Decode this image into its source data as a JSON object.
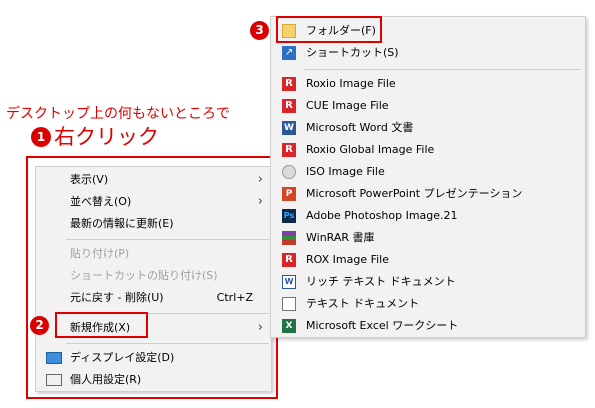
{
  "annotations": {
    "desc": "デスクトップ上の何もないところで",
    "step1_number": "1",
    "step1_label": "右クリック",
    "step2_number": "2",
    "step3_number": "3"
  },
  "context_menu": {
    "items": [
      {
        "label": "表示(V)"
      },
      {
        "label": "並べ替え(O)"
      },
      {
        "label": "最新の情報に更新(E)"
      },
      {
        "label": "貼り付け(P)"
      },
      {
        "label": "ショートカットの貼り付け(S)"
      },
      {
        "label": "元に戻す - 削除(U)",
        "shortcut": "Ctrl+Z"
      },
      {
        "label": "新規作成(X)"
      },
      {
        "label": "ディスプレイ設定(D)"
      },
      {
        "label": "個人用設定(R)"
      }
    ],
    "submenu_arrow": "›"
  },
  "new_submenu": {
    "items": [
      {
        "label": "フォルダー(F)",
        "icon": "folder-icon"
      },
      {
        "label": "ショートカット(S)",
        "icon": "shortcut-icon"
      },
      {
        "label": "Roxio Image File",
        "icon": "roxio-icon"
      },
      {
        "label": "CUE Image File",
        "icon": "roxio-icon"
      },
      {
        "label": "Microsoft Word 文書",
        "icon": "word-icon"
      },
      {
        "label": "Roxio Global Image File",
        "icon": "roxio-icon"
      },
      {
        "label": "ISO Image File",
        "icon": "iso-icon"
      },
      {
        "label": "Microsoft PowerPoint プレゼンテーション",
        "icon": "powerpoint-icon"
      },
      {
        "label": "Adobe Photoshop Image.21",
        "icon": "photoshop-icon"
      },
      {
        "label": "WinRAR 書庫",
        "icon": "winrar-icon"
      },
      {
        "label": "ROX Image File",
        "icon": "roxio-icon"
      },
      {
        "label": "リッチ テキスト ドキュメント",
        "icon": "rich-text-icon"
      },
      {
        "label": "テキスト ドキュメント",
        "icon": "text-document-icon"
      },
      {
        "label": "Microsoft Excel ワークシート",
        "icon": "excel-icon"
      }
    ]
  },
  "colors": {
    "annotation_red": "#e00000",
    "menu_bg": "#f2f2f2"
  }
}
